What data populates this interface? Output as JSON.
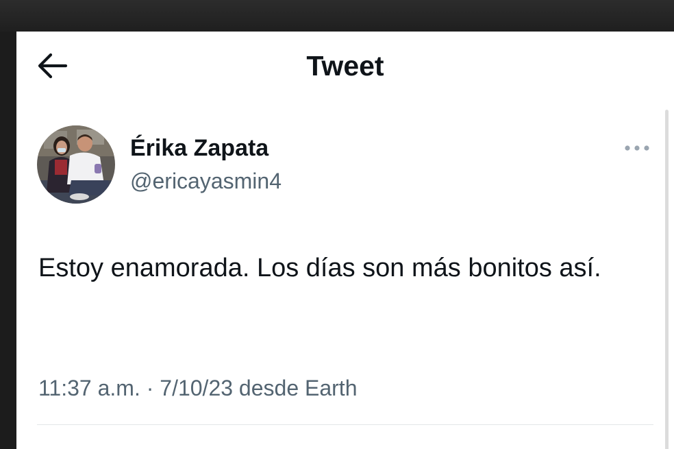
{
  "header": {
    "back_icon": "arrow-left-icon",
    "title": "Tweet"
  },
  "tweet": {
    "author": {
      "display_name": "Érika Zapata",
      "handle": "@ericayasmin4",
      "avatar": "profile-photo"
    },
    "more_icon": "ellipsis-icon",
    "text": "Estoy enamorada. Los días son más bonitos así.",
    "meta": "11:37 a.m. · 7/10/23 desde Earth"
  },
  "colors": {
    "primary_text": "#0f1419",
    "secondary_text": "#536471",
    "background": "#ffffff",
    "divider": "#e3e6e8"
  }
}
